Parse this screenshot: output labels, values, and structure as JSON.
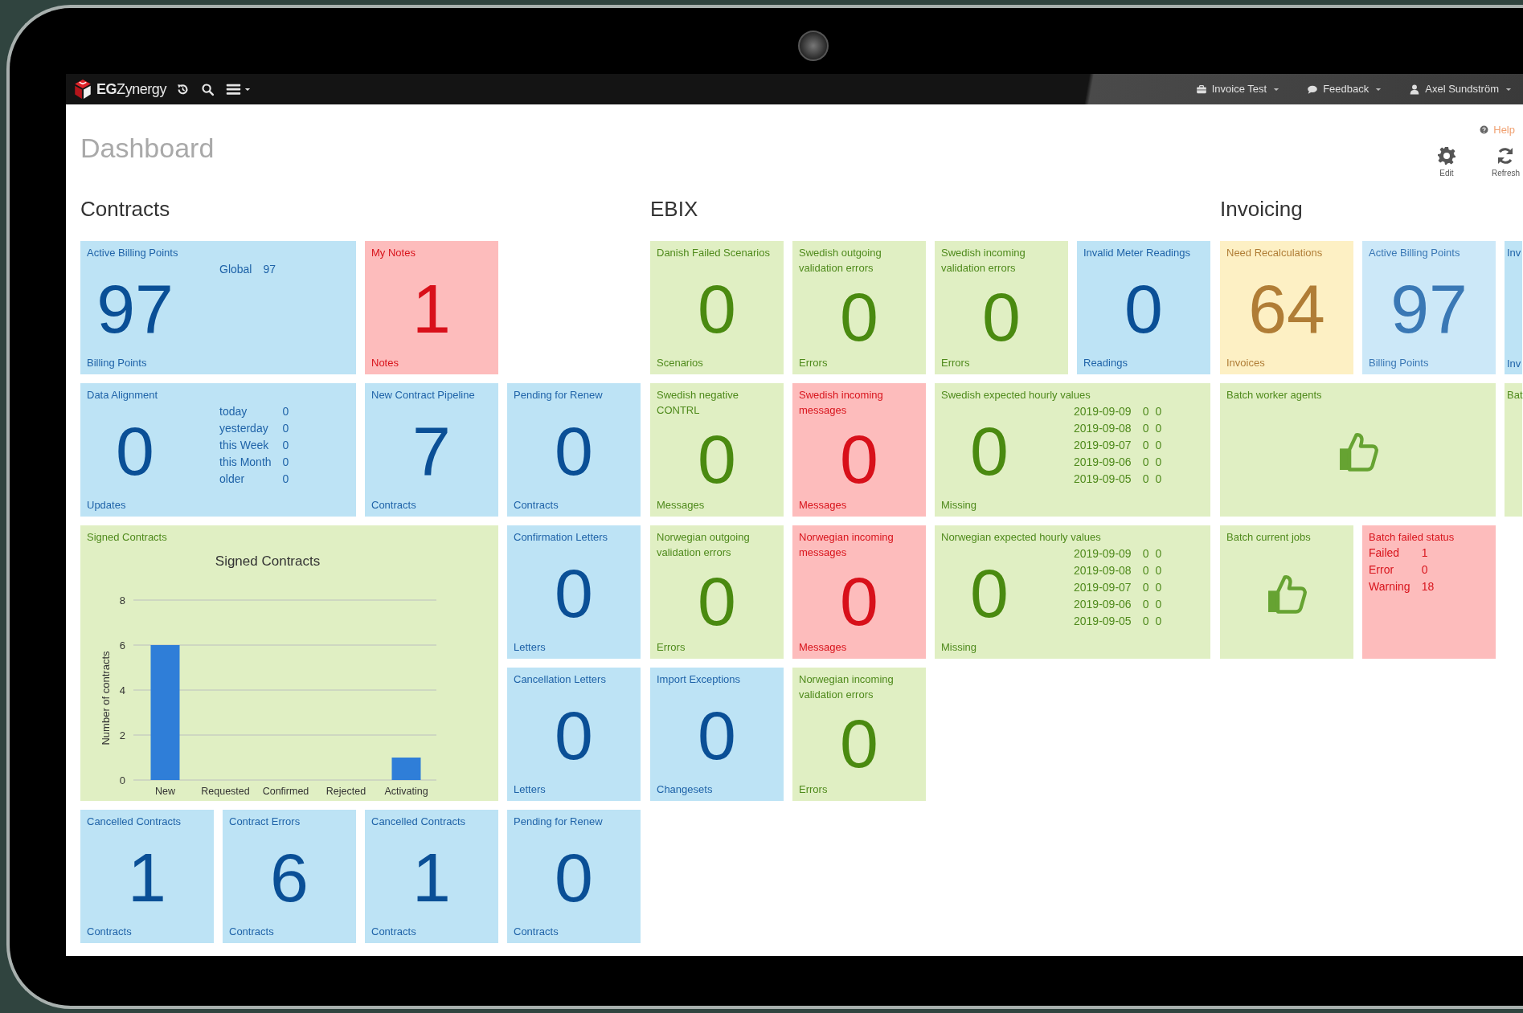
{
  "topbar": {
    "brand": "**EG**Zynergy",
    "menus": [
      {
        "label": "Invoice Test"
      },
      {
        "label": "Feedback"
      },
      {
        "label": "Axel Sundström"
      }
    ]
  },
  "page": {
    "title": "Dashboard",
    "help": "Help",
    "actions": [
      "Edit",
      "Refresh"
    ]
  },
  "sections": [
    {
      "heading": "Contracts",
      "tiles": [
        {
          "kind": "number",
          "color": "#bde3f5",
          "title": "Active Billing Points",
          "value": "97",
          "unit": "Billing Points",
          "aside": [
            {
              "label": "Global",
              "values": [
                "97"
              ]
            }
          ]
        },
        {
          "kind": "number",
          "color": "#fdbcbc",
          "title": "My Notes",
          "value": "1",
          "unit": "Notes"
        },
        {
          "kind": "number",
          "color": "#bde3f5",
          "title": "Data Alignment",
          "value": "0",
          "unit": "Updates",
          "aside": [
            {
              "label": "today",
              "values": [
                "0"
              ]
            },
            {
              "label": "yesterday",
              "values": [
                "0"
              ]
            },
            {
              "label": "this Week",
              "values": [
                "0"
              ]
            },
            {
              "label": "this Month",
              "values": [
                "0"
              ]
            },
            {
              "label": "older",
              "values": [
                "0"
              ]
            }
          ]
        },
        {
          "kind": "number",
          "color": "#bde3f5",
          "title": "New Contract Pipeline",
          "value": "7",
          "unit": "Contracts"
        },
        {
          "kind": "number",
          "color": "#bde3f5",
          "title": "Pending for Renew",
          "value": "0",
          "unit": "Contracts"
        },
        {
          "kind": "chart",
          "color": "#e0efc3",
          "title": "Signed Contracts",
          "chart_data": {
            "type": "bar",
            "title": "Signed Contracts",
            "ylabel": "Number of contracts",
            "categories": [
              "New",
              "Requested",
              "Confirmed",
              "Rejected",
              "Activating"
            ],
            "values": [
              6,
              0,
              0,
              0,
              1
            ],
            "ylim": [
              0,
              8
            ],
            "yticks": [
              0,
              2,
              4,
              6,
              8
            ],
            "grid": true
          }
        },
        {
          "kind": "number",
          "color": "#bde3f5",
          "title": "Confirmation Letters",
          "value": "0",
          "unit": "Letters"
        },
        {
          "kind": "number",
          "color": "#bde3f5",
          "title": "Cancellation Letters",
          "value": "0",
          "unit": "Letters"
        },
        {
          "kind": "number",
          "color": "#bde3f5",
          "title": "Cancelled Contracts",
          "value": "1",
          "unit": "Contracts"
        },
        {
          "kind": "number",
          "color": "#bde3f5",
          "title": "Contract Errors",
          "value": "6",
          "unit": "Contracts"
        },
        {
          "kind": "number",
          "color": "#bde3f5",
          "title": "Cancelled Contracts",
          "value": "1",
          "unit": "Contracts"
        },
        {
          "kind": "number",
          "color": "#bde3f5",
          "title": "Pending for Renew",
          "value": "0",
          "unit": "Contracts"
        }
      ]
    },
    {
      "heading": "EBIX",
      "tiles": [
        {
          "kind": "number",
          "color": "#e0efc3",
          "title": "Danish Failed Scenarios",
          "value": "0",
          "unit": "Scenarios"
        },
        {
          "kind": "number",
          "color": "#e0efc3",
          "title": "Swedish outgoing validation errors",
          "value": "0",
          "unit": "Errors"
        },
        {
          "kind": "number",
          "color": "#e0efc3",
          "title": "Swedish incoming validation errors",
          "value": "0",
          "unit": "Errors"
        },
        {
          "kind": "number",
          "color": "#bde3f5",
          "title": "Invalid Meter Readings",
          "value": "0",
          "unit": "Readings"
        },
        {
          "kind": "number",
          "color": "#e0efc3",
          "title": "Swedish negative CONTRL",
          "value": "0",
          "unit": "Messages"
        },
        {
          "kind": "number",
          "color": "#fdbcbc",
          "title": "Swedish incoming messages",
          "value": "0",
          "unit": "Messages"
        },
        {
          "kind": "number",
          "color": "#e0efc3",
          "title": "Swedish expected hourly values",
          "value": "0",
          "unit": "Missing",
          "aside": [
            {
              "label": "2019-09-09",
              "values": [
                "0",
                "0"
              ]
            },
            {
              "label": "2019-09-08",
              "values": [
                "0",
                "0"
              ]
            },
            {
              "label": "2019-09-07",
              "values": [
                "0",
                "0"
              ]
            },
            {
              "label": "2019-09-06",
              "values": [
                "0",
                "0"
              ]
            },
            {
              "label": "2019-09-05",
              "values": [
                "0",
                "0"
              ]
            }
          ]
        },
        {
          "kind": "number",
          "color": "#e0efc3",
          "title": "Norwegian outgoing validation errors",
          "value": "0",
          "unit": "Errors"
        },
        {
          "kind": "number",
          "color": "#fdbcbc",
          "title": "Norwegian incoming messages",
          "value": "0",
          "unit": "Messages"
        },
        {
          "kind": "number",
          "color": "#e0efc3",
          "title": "Norwegian expected hourly values",
          "value": "0",
          "unit": "Missing",
          "aside": [
            {
              "label": "2019-09-09",
              "values": [
                "0",
                "0"
              ]
            },
            {
              "label": "2019-09-08",
              "values": [
                "0",
                "0"
              ]
            },
            {
              "label": "2019-09-07",
              "values": [
                "0",
                "0"
              ]
            },
            {
              "label": "2019-09-06",
              "values": [
                "0",
                "0"
              ]
            },
            {
              "label": "2019-09-05",
              "values": [
                "0",
                "0"
              ]
            }
          ]
        },
        {
          "kind": "number",
          "color": "#bde3f5",
          "title": "Import Exceptions",
          "value": "0",
          "unit": "Changesets"
        },
        {
          "kind": "number",
          "color": "#e0efc3",
          "title": "Norwegian incoming validation errors",
          "value": "0",
          "unit": "Errors"
        }
      ]
    },
    {
      "heading": "Invoicing",
      "tiles": [
        {
          "kind": "number",
          "color": "#fdf0c4",
          "title": "Need Recalculations",
          "value": "64",
          "unit": "Invoices"
        },
        {
          "kind": "number",
          "color": "#cce8f8",
          "title": "Active Billing Points",
          "value": "97",
          "unit": "Billing Points"
        },
        {
          "kind": "stub",
          "color": "#bde3f5",
          "title": "Inv",
          "unit": "Inv"
        },
        {
          "kind": "icon",
          "color": "#e0efc3",
          "title": "Batch worker agents"
        },
        {
          "kind": "stub",
          "color": "#e0efc3",
          "title": "Bat"
        },
        {
          "kind": "icon",
          "color": "#e0efc3",
          "title": "Batch current jobs"
        },
        {
          "kind": "list",
          "color": "#fdbcbc",
          "title": "Batch failed status",
          "aside": [
            {
              "label": "Failed",
              "values": [
                "1"
              ]
            },
            {
              "label": "Error",
              "values": [
                "0"
              ]
            },
            {
              "label": "Warning",
              "values": [
                "18"
              ]
            }
          ]
        }
      ]
    }
  ]
}
